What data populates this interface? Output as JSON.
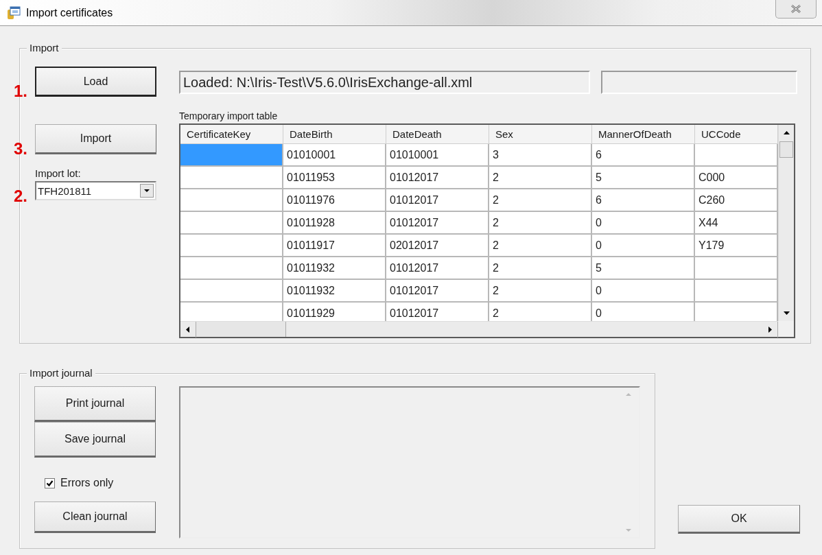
{
  "window": {
    "title": "Import certificates"
  },
  "import_group": {
    "title": "Import",
    "load_button": {
      "label": "Load",
      "step": "1.",
      "default": true
    },
    "import_button": {
      "label": "Import",
      "step": "3.",
      "default": false
    },
    "import_lot": {
      "label": "Import lot:",
      "value": "TFH201811",
      "step": "2."
    },
    "loaded_field": {
      "value": "Loaded: N:\\Iris-Test\\V5.6.0\\IrisExchange-all.xml"
    },
    "table": {
      "title": "Temporary import table",
      "columns": [
        "CertificateKey",
        "DateBirth",
        "DateDeath",
        "Sex",
        "MannerOfDeath",
        "UCCode"
      ],
      "rows": [
        {
          "selected": true,
          "cells": [
            null,
            "01010001",
            "01010001",
            "3",
            "6",
            null
          ]
        },
        {
          "selected": false,
          "cells": [
            null,
            "01011953",
            "01012017",
            "2",
            "5",
            "C000"
          ]
        },
        {
          "selected": false,
          "cells": [
            null,
            "01011976",
            "01012017",
            "2",
            "6",
            "C260"
          ]
        },
        {
          "selected": false,
          "cells": [
            null,
            "01011928",
            "01012017",
            "2",
            "0",
            "X44"
          ]
        },
        {
          "selected": false,
          "cells": [
            null,
            "01011917",
            "02012017",
            "2",
            "0",
            "Y179"
          ]
        },
        {
          "selected": false,
          "cells": [
            null,
            "01011932",
            "01012017",
            "2",
            "5",
            null
          ]
        },
        {
          "selected": false,
          "cells": [
            null,
            "01011932",
            "01012017",
            "2",
            "0",
            null
          ]
        },
        {
          "selected": false,
          "cells": [
            null,
            "01011929",
            "01012017",
            "2",
            "0",
            null
          ]
        }
      ]
    }
  },
  "journal_group": {
    "title": "Import journal",
    "controls": [
      {
        "kind": "button",
        "label": "Print journal"
      },
      {
        "kind": "button",
        "label": "Save journal"
      },
      {
        "kind": "checkbox",
        "label": "Errors only",
        "checked": true
      },
      {
        "kind": "button",
        "label": "Clean journal"
      }
    ]
  },
  "ok_button": {
    "label": "OK"
  }
}
